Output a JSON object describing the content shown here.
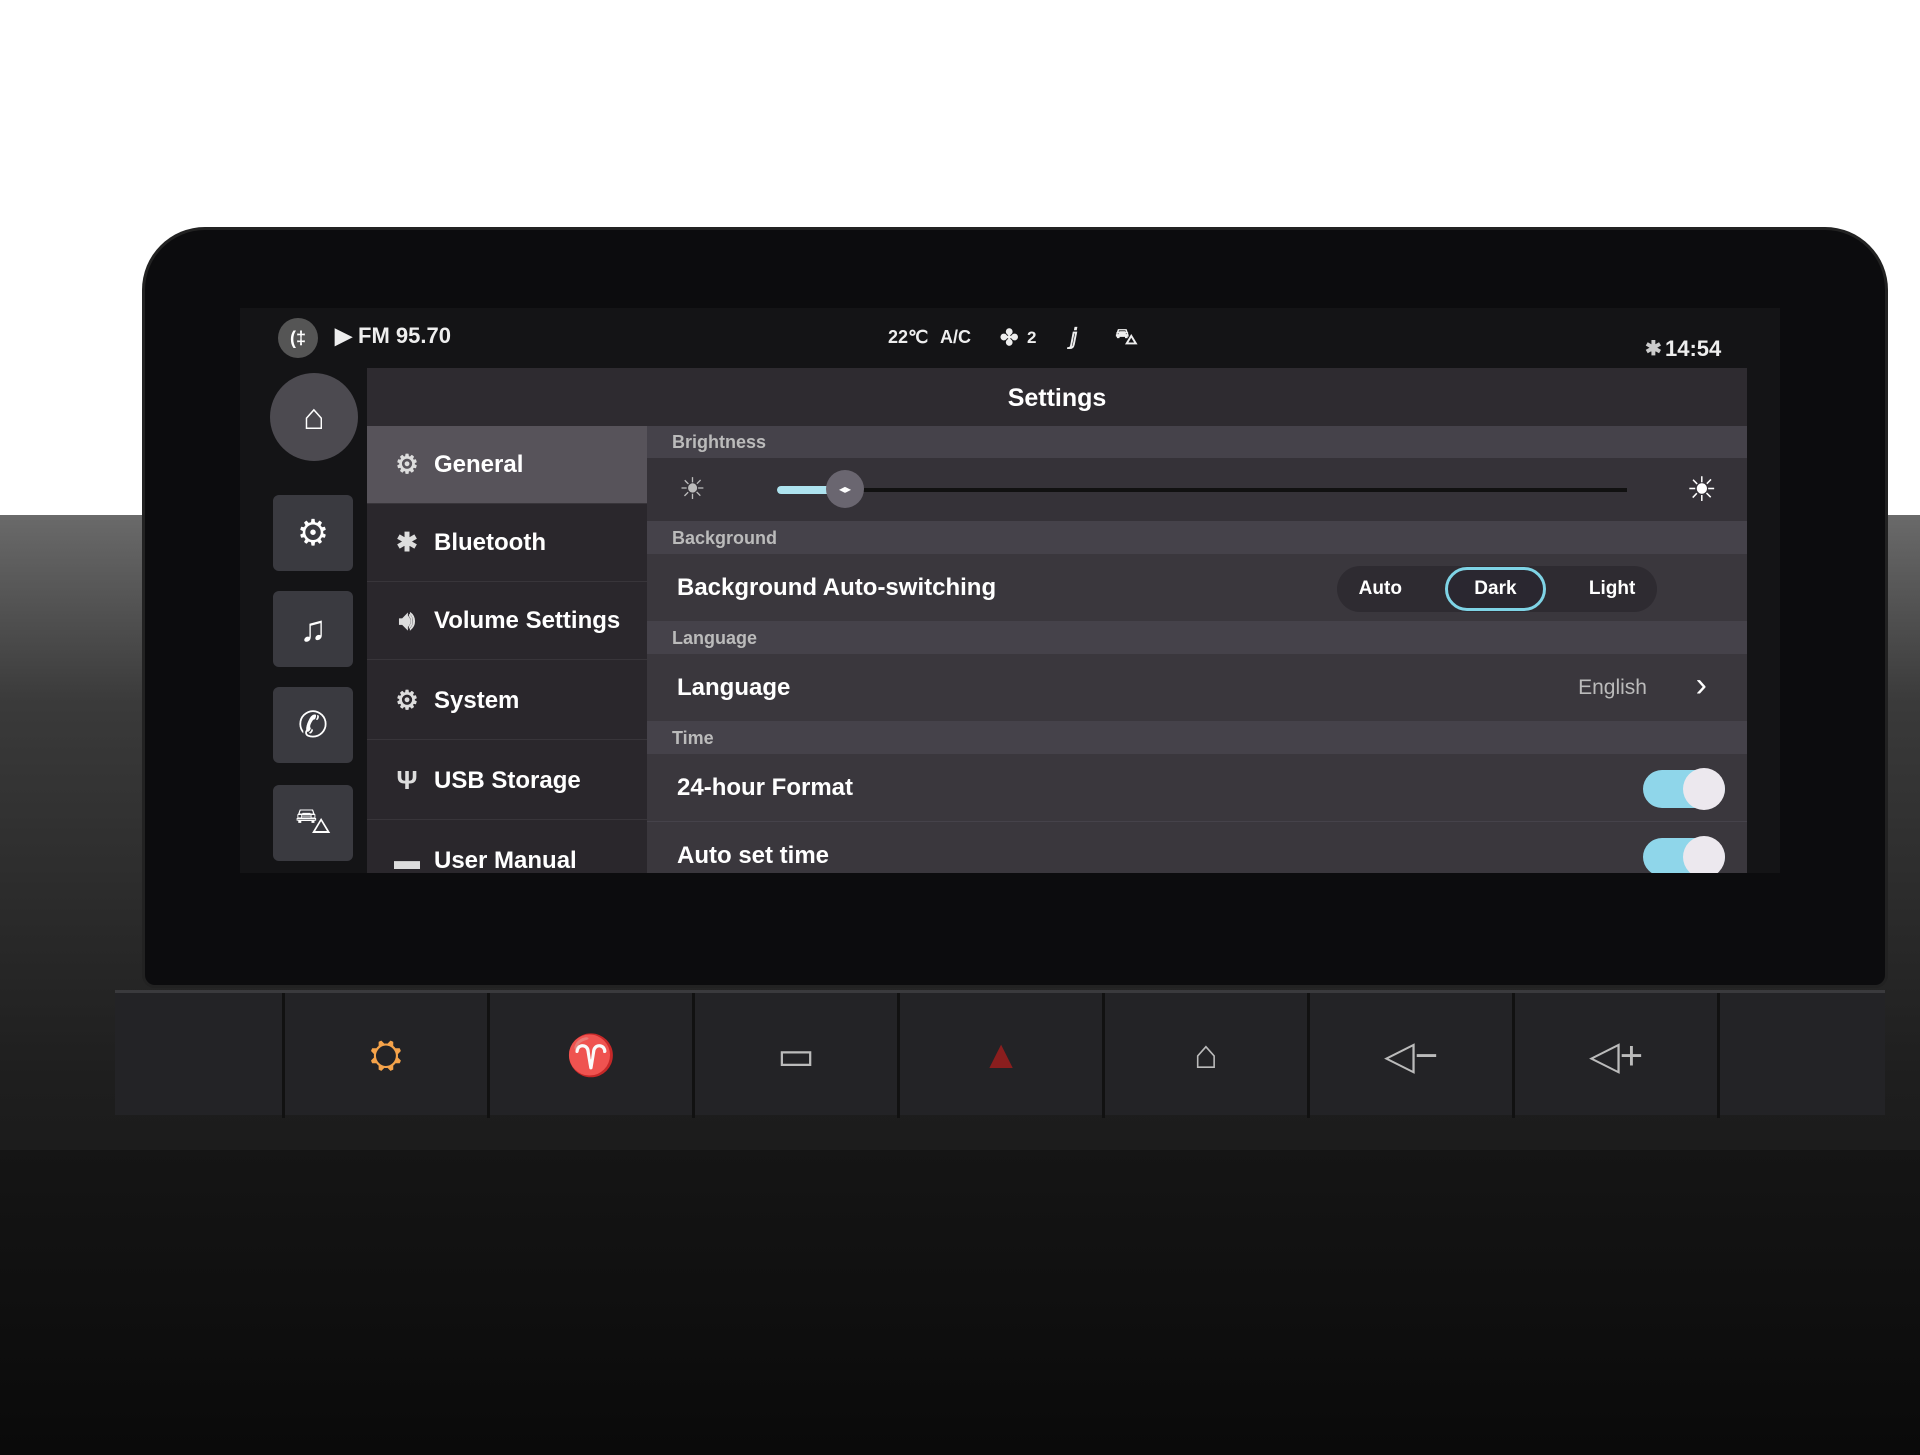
{
  "status_bar": {
    "radio": "FM 95.70",
    "temperature": "22℃",
    "ac": "A/C",
    "fan_level": "2",
    "time": "14:54",
    "icons": [
      "fog-light-icon",
      "play-icon",
      "fan-icon",
      "seat-heat-icon",
      "car-icon",
      "bluetooth-icon"
    ]
  },
  "rail": {
    "items": [
      "home-icon",
      "gear-icon",
      "music-icon",
      "phone-icon",
      "car-icon"
    ]
  },
  "settings": {
    "title": "Settings",
    "menu": [
      {
        "label": "General",
        "icon": "gear-icon",
        "active": true
      },
      {
        "label": "Bluetooth",
        "icon": "bluetooth-icon"
      },
      {
        "label": "Volume Settings",
        "icon": "speaker-icon"
      },
      {
        "label": "System",
        "icon": "gears-icon"
      },
      {
        "label": "USB Storage",
        "icon": "usb-icon"
      },
      {
        "label": "User Manual",
        "icon": "book-icon"
      }
    ],
    "brightness": {
      "label": "Brightness",
      "value_percent": 8
    },
    "background": {
      "label": "Background",
      "row_label": "Background Auto-switching",
      "options": [
        "Auto",
        "Dark",
        "Light"
      ],
      "selected": "Dark"
    },
    "language": {
      "label": "Language",
      "row_label": "Language",
      "value": "English"
    },
    "time": {
      "label": "Time",
      "format_label": "24-hour Format",
      "format_on": true,
      "auto_label": "Auto set time",
      "auto_on": true
    }
  },
  "hardware_buttons": [
    "fog-light-icon",
    "windshield-defrost-icon",
    "rear-defrost-icon",
    "hazard-icon",
    "home-icon",
    "volume-down-icon",
    "volume-up-icon"
  ],
  "colors": {
    "accent": "#8fd6ea",
    "hw_lit": "#f5a34a",
    "hazard": "#8a1e1e"
  }
}
